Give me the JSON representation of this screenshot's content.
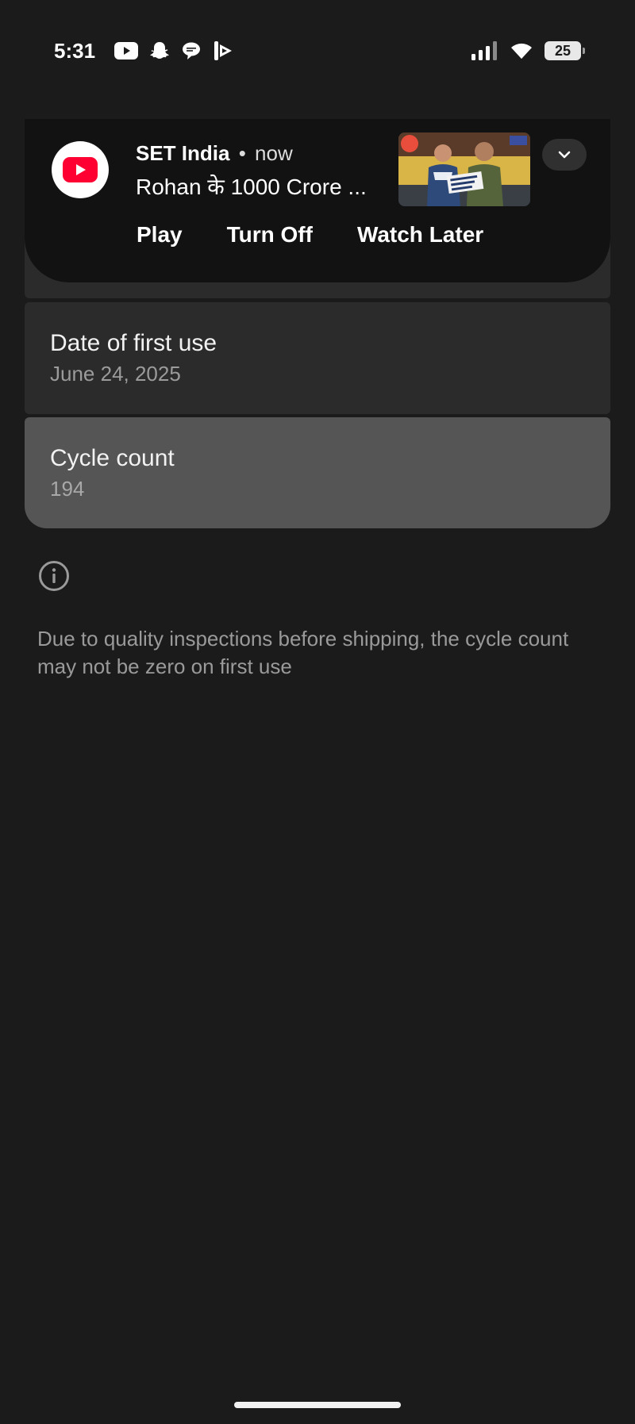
{
  "status_bar": {
    "time": "5:31",
    "battery_level": "25",
    "notification_icons": [
      "youtube-icon",
      "snapchat-icon",
      "messages-icon",
      "video-app-icon"
    ],
    "system_icons": [
      "signal-icon",
      "wifi-icon",
      "battery-icon"
    ]
  },
  "notification": {
    "app_icon": "youtube-icon",
    "source": "SET India",
    "separator": "•",
    "time": "now",
    "body": "Rohan के 1000 Crore ...",
    "actions": {
      "play": "Play",
      "turn_off": "Turn Off",
      "watch_later": "Watch Later"
    },
    "expand_icon": "chevron-down-icon",
    "accent_color": "#ff0033"
  },
  "battery_info": {
    "first_use": {
      "label": "Date of first use",
      "value": "June 24, 2025"
    },
    "cycle_count": {
      "label": "Cycle count",
      "value": "194"
    }
  },
  "info": {
    "icon": "info-icon",
    "text": "Due to quality inspections before shipping, the cycle count may not be zero on first use"
  }
}
